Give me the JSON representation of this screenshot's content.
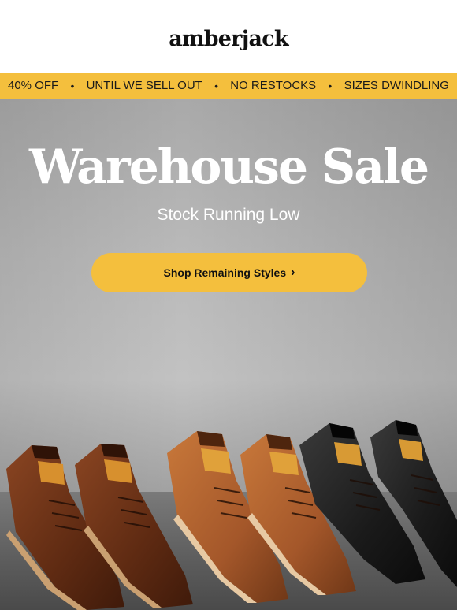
{
  "header": {
    "logo_text": "amberjack"
  },
  "ticker": {
    "items": [
      "40% OFF",
      "UNTIL WE SELL OUT",
      "NO RESTOCKS",
      "SIZES DWINDLING"
    ],
    "separator": "•"
  },
  "hero": {
    "title": "Warehouse Sale",
    "subtitle": "Stock Running Low",
    "cta_label": "Shop Remaining Styles",
    "cta_chevron": "›"
  },
  "colors": {
    "accent_yellow": "#f4bf3d",
    "shoe_dark_brown": "#6b3217",
    "shoe_tan": "#b0602a",
    "shoe_black": "#1b1b1b"
  },
  "images": {
    "shoes": [
      {
        "color": "dark-brown"
      },
      {
        "color": "dark-brown"
      },
      {
        "color": "tan"
      },
      {
        "color": "tan"
      },
      {
        "color": "black"
      },
      {
        "color": "black"
      }
    ]
  }
}
